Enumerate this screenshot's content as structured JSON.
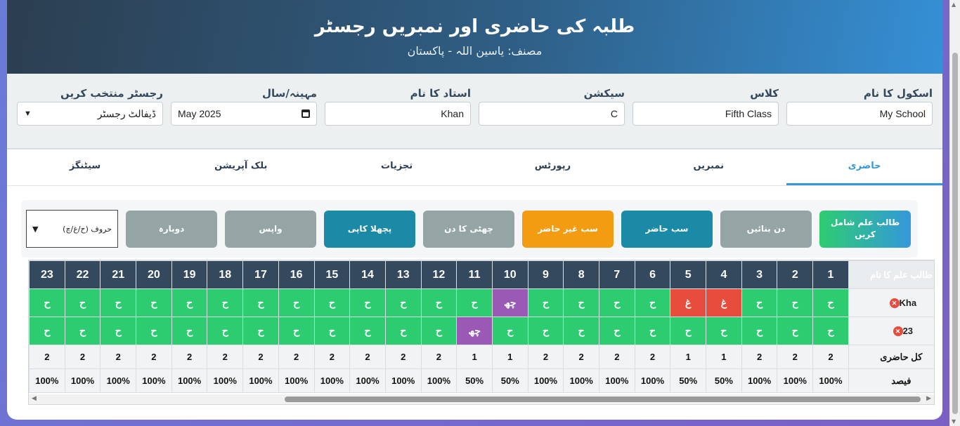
{
  "header": {
    "title": "طلبہ کی حاضری اور نمبریں رجسٹر",
    "author": "مصنف: یاسین اللہ - پاکستان"
  },
  "form": {
    "school": {
      "label": "اسکول کا نام",
      "value": "My School"
    },
    "class": {
      "label": "کلاس",
      "value": "Fifth Class"
    },
    "section": {
      "label": "سیکشن",
      "value": "C"
    },
    "teacher": {
      "label": "استاد کا نام",
      "value": "Khan"
    },
    "month": {
      "label": "مہینہ/سال",
      "value": "May 2025"
    },
    "register": {
      "label": "رجسٹر منتخب کریں",
      "value": "ڈیفالٹ رجسٹر"
    }
  },
  "tabs": [
    "حاضری",
    "نمبریں",
    "رپورٹس",
    "تجزیات",
    "بلک آپریشن",
    "سیٹنگز"
  ],
  "active_tab": 0,
  "actions": {
    "add_student": "طالب علم شامل کریں",
    "make_day": "دن بنائیں",
    "all_present": "سب حاضر",
    "all_absent": "سب غیر حاضر",
    "holiday": "چھٹی کا دن",
    "copy_previous": "پچھلا کاپی",
    "undo": "واپس",
    "redo": "دوبارہ",
    "mode_select": "حروف (ح/غ/چ)"
  },
  "grid": {
    "name_header": "طالب علم کا نام",
    "days": [
      1,
      2,
      3,
      4,
      5,
      6,
      7,
      8,
      9,
      10,
      11,
      12,
      13,
      14,
      15,
      16,
      17,
      18,
      19,
      20,
      21,
      22,
      23
    ],
    "students": [
      {
        "name": "Kha",
        "marks": [
          "ح",
          "ح",
          "ح",
          "غ",
          "غ",
          "ح",
          "ح",
          "ح",
          "ح",
          "چھ",
          "ح",
          "ح",
          "ح",
          "ح",
          "ح",
          "ح",
          "ح",
          "ح",
          "ح",
          "ح",
          "ح",
          "ح",
          "ح"
        ],
        "status": [
          "P",
          "P",
          "P",
          "A",
          "A",
          "P",
          "P",
          "P",
          "P",
          "L",
          "P",
          "P",
          "P",
          "P",
          "P",
          "P",
          "P",
          "P",
          "P",
          "P",
          "P",
          "P",
          "P"
        ]
      },
      {
        "name": "23",
        "marks": [
          "ح",
          "ح",
          "ح",
          "ح",
          "ح",
          "ح",
          "ح",
          "ح",
          "ح",
          "ح",
          "چھ",
          "ح",
          "ح",
          "ح",
          "ح",
          "ح",
          "ح",
          "ح",
          "ح",
          "ح",
          "ح",
          "ح",
          "ح"
        ],
        "status": [
          "P",
          "P",
          "P",
          "P",
          "P",
          "P",
          "P",
          "P",
          "P",
          "P",
          "L",
          "P",
          "P",
          "P",
          "P",
          "P",
          "P",
          "P",
          "P",
          "P",
          "P",
          "P",
          "P"
        ]
      }
    ],
    "total_label": "کل حاضری",
    "totals": [
      "2",
      "2",
      "2",
      "1",
      "1",
      "2",
      "2",
      "2",
      "2",
      "1",
      "1",
      "2",
      "2",
      "2",
      "2",
      "2",
      "2",
      "2",
      "2",
      "2",
      "2",
      "2",
      "2"
    ],
    "percent_label": "فیصد",
    "percents": [
      "100%",
      "100%",
      "100%",
      "50%",
      "50%",
      "100%",
      "100%",
      "100%",
      "100%",
      "50%",
      "50%",
      "100%",
      "100%",
      "100%",
      "100%",
      "100%",
      "100%",
      "100%",
      "100%",
      "100%",
      "100%",
      "100%",
      "100%"
    ]
  },
  "colors": {
    "present": "#2ecc71",
    "absent": "#e74c3c",
    "leave": "#9b59b6",
    "accent": "#3498db",
    "header_dark": "#34495e"
  }
}
